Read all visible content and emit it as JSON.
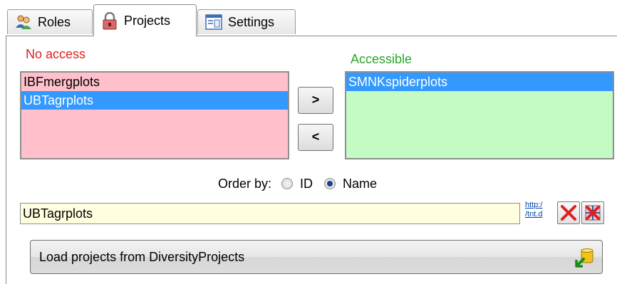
{
  "tabs": [
    {
      "label": "Roles",
      "icon": "users-icon",
      "active": false
    },
    {
      "label": "Projects",
      "icon": "lock-icon",
      "active": true
    },
    {
      "label": "Settings",
      "icon": "settings-window-icon",
      "active": false
    }
  ],
  "no_access": {
    "label": "No access",
    "items": [
      "IBFmergplots",
      "UBTagrplots"
    ],
    "selected_index": 1
  },
  "accessible": {
    "label": "Accessible",
    "items": [
      "SMNKspiderplots"
    ],
    "selected_index": 0
  },
  "move_buttons": {
    "right": ">",
    "left": "<"
  },
  "order_by": {
    "label": "Order by:",
    "options": [
      "ID",
      "Name"
    ],
    "selected": "Name"
  },
  "project_name": {
    "value": "UBTagrplots",
    "link_line1": "http:/",
    "link_line2": "/tnt.d"
  },
  "load_button": {
    "label": "Load projects from DiversityProjects"
  },
  "colors": {
    "no_access_bg": "#ffc0cb",
    "accessible_bg": "#c4fbc4",
    "selection": "#3399ff",
    "no_access_label": "#e02020",
    "accessible_label": "#2aa52a"
  }
}
